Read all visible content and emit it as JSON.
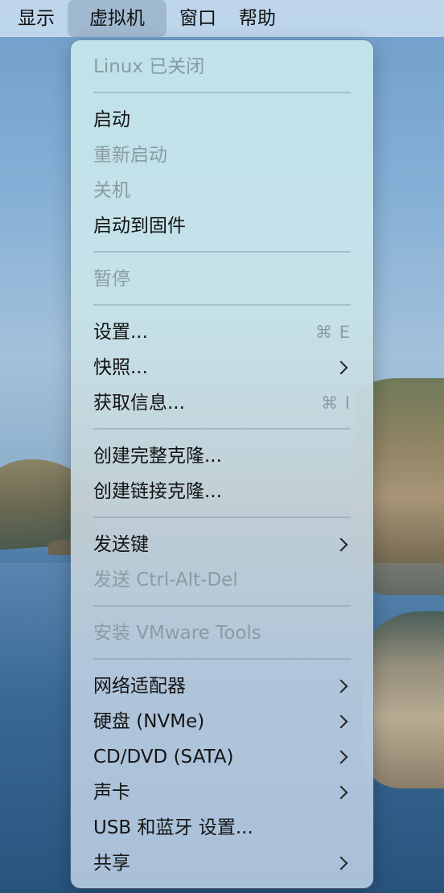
{
  "menubar": {
    "items": [
      {
        "label": "显示"
      },
      {
        "label": "虚拟机"
      },
      {
        "label": "窗口"
      },
      {
        "label": "帮助"
      }
    ]
  },
  "menu": {
    "status_label": "Linux 已关闭",
    "start": "启动",
    "restart": "重新启动",
    "shutdown": "关机",
    "boot_firmware": "启动到固件",
    "pause": "暂停",
    "settings": "设置...",
    "settings_shortcut": "⌘ E",
    "snapshots": "快照...",
    "get_info": "获取信息...",
    "get_info_shortcut": "⌘ I",
    "full_clone": "创建完整克隆...",
    "linked_clone": "创建链接克隆...",
    "send_keys": "发送键",
    "send_cad": "发送 Ctrl-Alt-Del",
    "install_tools": "安装 VMware Tools",
    "network_adapter": "网络适配器",
    "hard_disk": "硬盘 (NVMe)",
    "cd_dvd": "CD/DVD (SATA)",
    "sound_card": "声卡",
    "usb_bluetooth": "USB 和蓝牙 设置...",
    "sharing": "共享"
  }
}
